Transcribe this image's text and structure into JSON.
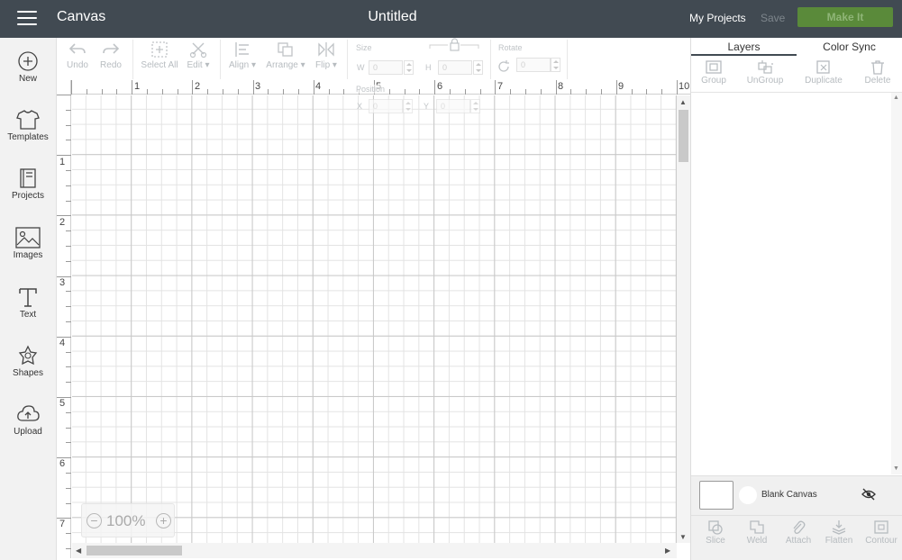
{
  "header": {
    "app_name": "Canvas",
    "doc_title": "Untitled",
    "my_projects": "My Projects",
    "save": "Save",
    "make_it": "Make It"
  },
  "sidebar": {
    "items": [
      {
        "label": "New",
        "icon": "plus-circle-icon"
      },
      {
        "label": "Templates",
        "icon": "tshirt-icon"
      },
      {
        "label": "Projects",
        "icon": "projects-icon"
      },
      {
        "label": "Images",
        "icon": "image-icon"
      },
      {
        "label": "Text",
        "icon": "text-icon"
      },
      {
        "label": "Shapes",
        "icon": "shapes-icon"
      },
      {
        "label": "Upload",
        "icon": "cloud-upload-icon"
      }
    ]
  },
  "toolbar": {
    "undo": "Undo",
    "redo": "Redo",
    "select_all": "Select All",
    "edit": "Edit",
    "align": "Align",
    "arrange": "Arrange",
    "flip": "Flip",
    "size": "Size",
    "w": "W",
    "w_value": "0",
    "h": "H",
    "h_value": "0",
    "rotate": "Rotate",
    "rotate_value": "0",
    "position": "Position",
    "x": "X",
    "x_value": "0",
    "y": "Y",
    "y_value": "0"
  },
  "canvas": {
    "ruler_top": [
      "1",
      "2",
      "3",
      "4",
      "5",
      "6",
      "7",
      "8",
      "9",
      "10"
    ],
    "ruler_left": [
      "1",
      "2",
      "3",
      "4",
      "5",
      "6",
      "7"
    ],
    "zoom": "100%"
  },
  "right_panel": {
    "tabs": [
      "Layers",
      "Color Sync"
    ],
    "layer_tools": [
      "Group",
      "UnGroup",
      "Duplicate",
      "Delete"
    ],
    "blank_canvas": "Blank Canvas",
    "bottom_tools": [
      "Slice",
      "Weld",
      "Attach",
      "Flatten",
      "Contour"
    ]
  },
  "colors": {
    "topbar": "#414a52",
    "make_it": "#5a8a3a",
    "sidebar": "#f2f2f2"
  }
}
